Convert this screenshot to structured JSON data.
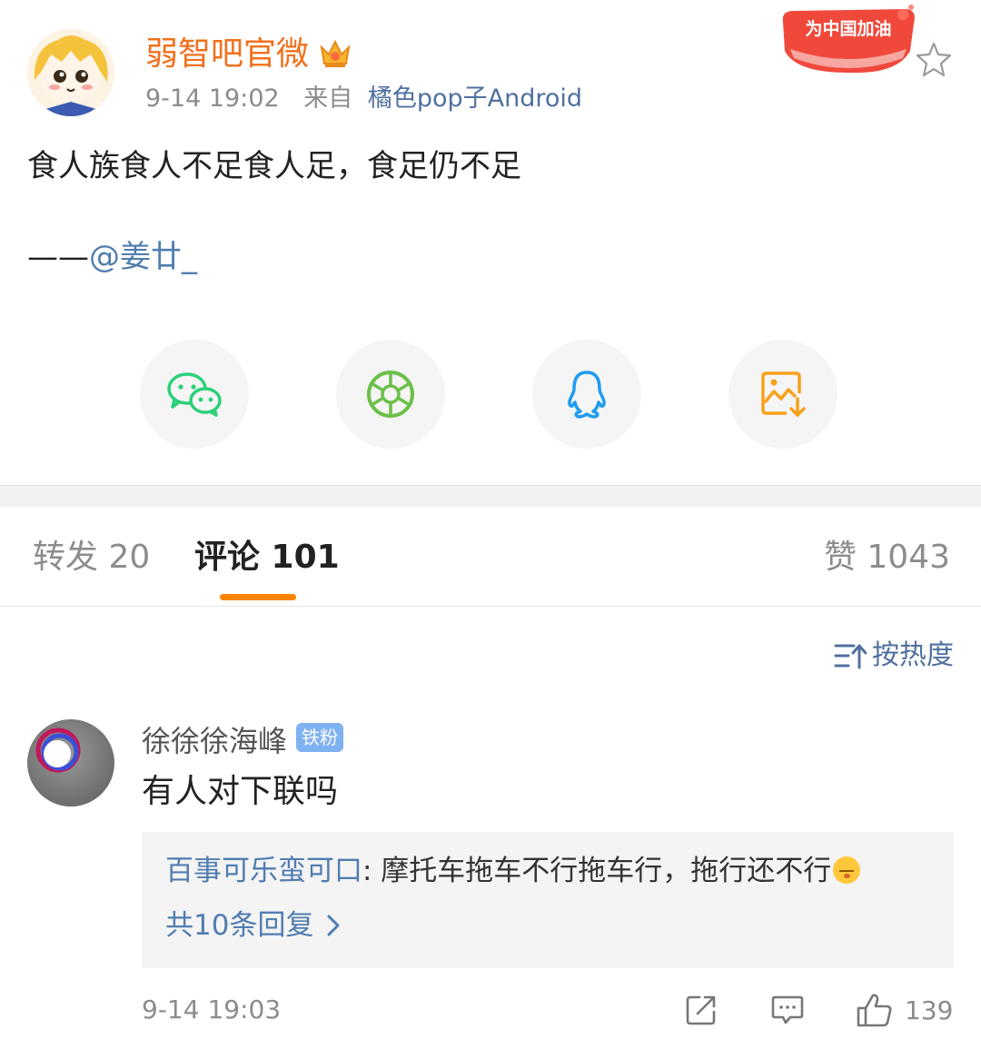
{
  "post": {
    "username": "弱智吧官微",
    "time": "9-14 19:02",
    "from_label": "来自",
    "source": "橘色pop子Android",
    "badge_text": "为中国加油",
    "content_line1": "食人族食人不足食人足，食足仍不足",
    "content_dash": "——",
    "content_mention": "@姜廿_"
  },
  "share": {
    "icons": [
      "wechat-icon",
      "moments-icon",
      "qq-icon",
      "save-image-icon"
    ],
    "colors": {
      "wechat": "#2bd07a",
      "moments": "#6cc04a",
      "qq": "#1e9cf0",
      "save": "#f7a21b"
    }
  },
  "tabs": {
    "repost_label": "转发 20",
    "comment_label": "评论 101",
    "like_label": "赞 1043",
    "active": "comment"
  },
  "sort": {
    "label": "按热度"
  },
  "comments": [
    {
      "name": "徐徐徐海峰",
      "badge": "铁粉",
      "text": "有人对下联吗",
      "reply_author": "百事可乐蛮可口",
      "reply_text": ": 摩托车拖车不行拖车行，拖行还不行",
      "reply_emoji": "smirk-emoji",
      "more_replies": "共10条回复",
      "time": "9-14 19:03",
      "likes": "139"
    }
  ],
  "colors": {
    "accent": "#ff8200",
    "link": "#507daf",
    "username": "#f1701d"
  }
}
